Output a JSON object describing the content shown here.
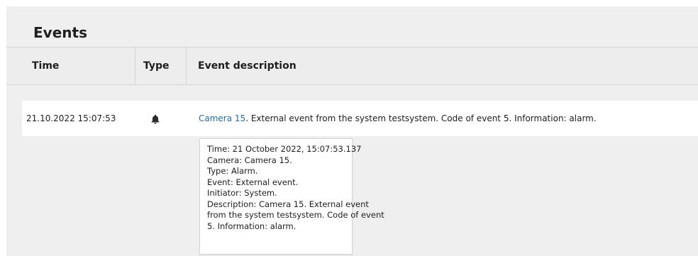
{
  "panel": {
    "title": "Events"
  },
  "table": {
    "columns": [
      "Time",
      "Type",
      "Event description"
    ],
    "rows": [
      {
        "time": "21.10.2022 15:07:53",
        "type_icon": "bell-icon",
        "camera_link": "Camera 15",
        "description_rest": ". External event from the system testsystem. Code of event 5. Information: alarm."
      }
    ]
  },
  "tooltip": {
    "lines": [
      "Time: 21 October 2022, 15:07:53.137",
      "Camera: Camera 15.",
      "Type: Alarm.",
      "Event: External event.",
      "Initiator: System.",
      "Description: Camera 15. External event",
      "from the system testsystem. Code of event",
      "5. Information: alarm."
    ]
  },
  "colors": {
    "panel_bg": "#efefef",
    "link": "#1e6fb0",
    "text": "#1e1e1e"
  }
}
